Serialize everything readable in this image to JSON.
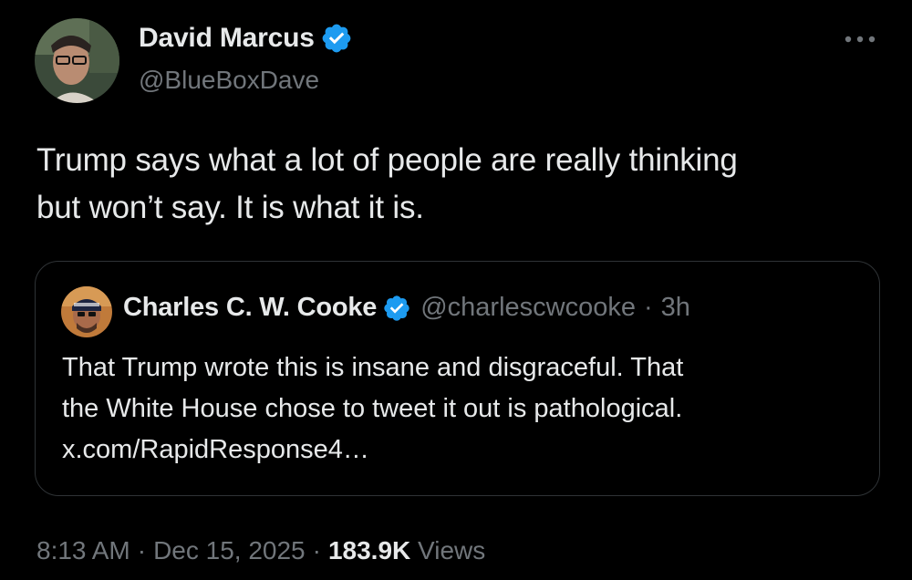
{
  "tweet": {
    "author": {
      "name": "David Marcus",
      "handle": "@BlueBoxDave",
      "verified": true
    },
    "more_icon": "more-horizontal-icon",
    "text_lines": [
      "Trump says what a lot of people are really thinking",
      "but won’t say. It is what it is."
    ],
    "quote": {
      "author": {
        "name": "Charles C. W. Cooke",
        "handle": "@charlescwcooke",
        "verified": true
      },
      "separator": "·",
      "time": "3h",
      "text_lines": [
        "That Trump wrote this is insane and disgraceful. That",
        "the White House chose to tweet it out is pathological.",
        "x.com/RapidResponse4…"
      ]
    },
    "meta": {
      "time": "8:13 AM",
      "separator": "·",
      "date": "Dec 15, 2025",
      "views_count": "183.9K",
      "views_label": "Views"
    }
  },
  "colors": {
    "background": "#000000",
    "text_primary": "#e7e9ea",
    "text_secondary": "#71767b",
    "verified_blue": "#1d9bf0",
    "border": "#2f3336"
  }
}
